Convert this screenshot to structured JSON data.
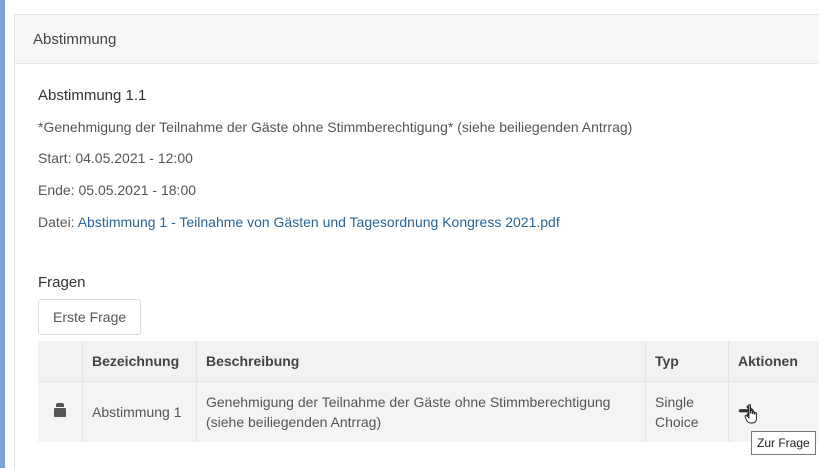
{
  "panel": {
    "header_title": "Abstimmung"
  },
  "vote": {
    "title": "Abstimmung 1.1",
    "description": "*Genehmigung der Teilnahme der Gäste ohne Stimmberechtigung* (siehe beiliegenden Antrrag)",
    "start": "Start: 04.05.2021 - 12:00",
    "end": "Ende: 05.05.2021 - 18:00",
    "file_label": "Datei: ",
    "file_link": "Abstimmung 1 - Teilnahme von Gästen und Tagesordnung Kongress 2021.pdf"
  },
  "questions": {
    "section_title": "Fragen",
    "first_button": "Erste Frage",
    "columns": [
      "",
      "Bezeichnung",
      "Beschreibung",
      "Typ",
      "Aktionen"
    ],
    "rows": [
      {
        "icon": "ballot-icon",
        "name": "Abstimmung 1",
        "description": "Genehmigung der Teilnahme der Gäste ohne Stimmberechtigung (siehe beiliegenden Antrrag)",
        "type": "Single Choice",
        "action_icon": "arrow-right-icon"
      }
    ]
  },
  "tooltip": {
    "text": "Zur Frage"
  }
}
